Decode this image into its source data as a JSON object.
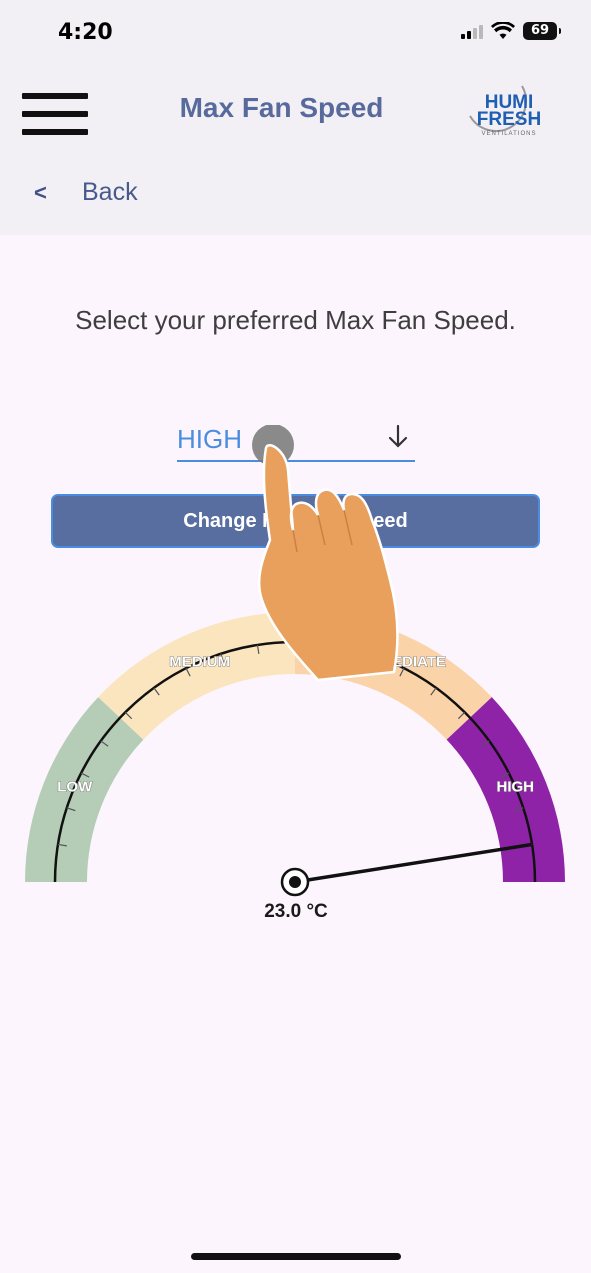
{
  "status_bar": {
    "time": "4:20",
    "battery": "69"
  },
  "header": {
    "title": "Max Fan Speed",
    "logo": {
      "line1": "HUMI",
      "line2": "FRESH",
      "tagline": "VENTILATIONS"
    },
    "back_label": "Back"
  },
  "main": {
    "prompt": "Select your preferred Max Fan Speed.",
    "select": {
      "value": "HIGH"
    },
    "button_label": "Change Max Fan Speed"
  },
  "gauge": {
    "zones": [
      {
        "label": "LOW",
        "color": "#b5cdb6"
      },
      {
        "label": "MEDIUM",
        "color": "#fbe5bf"
      },
      {
        "label": "INTERMEDIATE",
        "color": "#fbd3a8"
      },
      {
        "label": "HIGH",
        "color": "#8e23a8"
      }
    ],
    "needle_fraction": 0.95,
    "value_text": "23.0 °C"
  },
  "colors": {
    "accent": "#4a8de0",
    "title": "#58699c",
    "button": "#586da0",
    "background": "#fcf5fd",
    "header_bg": "#f2eff5"
  }
}
